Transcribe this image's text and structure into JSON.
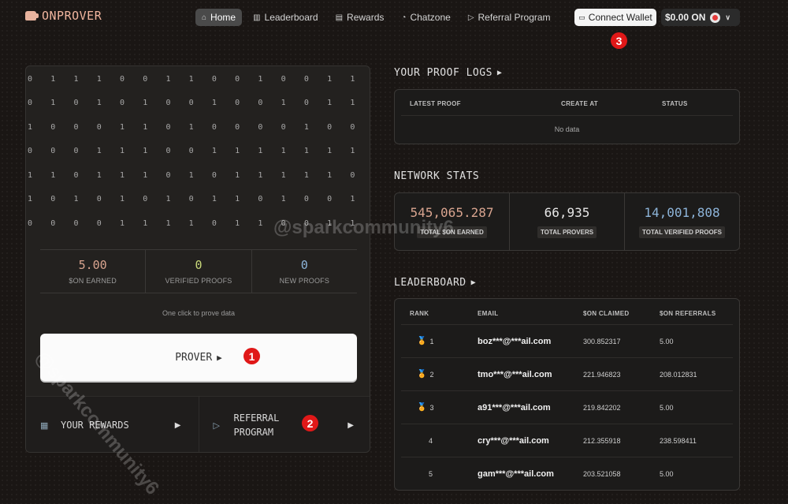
{
  "brand": {
    "name": "ONPROVER"
  },
  "nav": {
    "items": [
      {
        "label": "Home",
        "icon": "home-icon",
        "active": true
      },
      {
        "label": "Leaderboard",
        "icon": "leaderboard-icon"
      },
      {
        "label": "Rewards",
        "icon": "rewards-icon"
      },
      {
        "label": "Chatzone",
        "icon": "chat-icon"
      },
      {
        "label": "Referral Program",
        "icon": "referral-icon"
      }
    ],
    "connect_wallet": "Connect Wallet",
    "balance": "$0.00 ON"
  },
  "badges": {
    "b1": "1",
    "b2": "2",
    "b3": "3"
  },
  "binary_rows": [
    "0 1 1 1 0 0 1 1 0 0 1 0 0 1 1",
    "0 1 0 1 0 1 0 0 1 0 0 1 0 1 1",
    "1 0 0 0 1 1 0 1 0 0 0 0 1 0 0",
    "0 0 0 1 1 1 0 0 1 1 1 1 1 1 1",
    "1 1 0 1 1 1 0 1 0 1 1 1 1 1 0",
    "1 0 1 0 1 0 1 0 1 1 0 1 0 0 1",
    "0 0 0 0 1 1 1 1 0 1 1 0 0 1 1"
  ],
  "user_stats": [
    {
      "value": "5.00",
      "label": "$ON EARNED",
      "color": "#d9a48f"
    },
    {
      "value": "0",
      "label": "VERIFIED PROOFS",
      "color": "#c9d97a"
    },
    {
      "value": "0",
      "label": "NEW PROOFS",
      "color": "#8db4d9"
    }
  ],
  "prove_hint": "One click to prove data",
  "prover_button": "PROVER",
  "actions": {
    "rewards": "YOUR REWARDS",
    "referral_line1": "REFERRAL",
    "referral_line2": "PROGRAM"
  },
  "proof_logs": {
    "title": "YOUR PROOF LOGS",
    "headers": [
      "LATEST PROOF",
      "CREATE AT",
      "STATUS"
    ],
    "empty": "No data"
  },
  "network": {
    "title": "NETWORK STATS",
    "stats": [
      {
        "value": "545,065.287",
        "label": "TOTAL $ON EARNED",
        "color": "#d9a48f"
      },
      {
        "value": "66,935",
        "label": "TOTAL PROVERS",
        "color": "#e6e6e6"
      },
      {
        "value": "14,001,808",
        "label": "TOTAL VERIFIED PROOFS",
        "color": "#8db4d9"
      }
    ]
  },
  "leaderboard": {
    "title": "LEADERBOARD",
    "headers": [
      "RANK",
      "EMAIL",
      "$ON CLAIMED",
      "$ON REFERRALS"
    ],
    "rows": [
      {
        "rank": "1",
        "medal": "gold",
        "email": "boz***@***ail.com",
        "claimed": "300.852317",
        "referrals": "5.00"
      },
      {
        "rank": "2",
        "medal": "silver",
        "email": "tmo***@***ail.com",
        "claimed": "221.946823",
        "referrals": "208.012831"
      },
      {
        "rank": "3",
        "medal": "bronze",
        "email": "a91***@***ail.com",
        "claimed": "219.842202",
        "referrals": "5.00"
      },
      {
        "rank": "4",
        "medal": "",
        "email": "cry***@***ail.com",
        "claimed": "212.355918",
        "referrals": "238.598411"
      },
      {
        "rank": "5",
        "medal": "",
        "email": "gam***@***ail.com",
        "claimed": "203.521058",
        "referrals": "5.00"
      }
    ]
  },
  "watermark": "@sparkcommunity6"
}
